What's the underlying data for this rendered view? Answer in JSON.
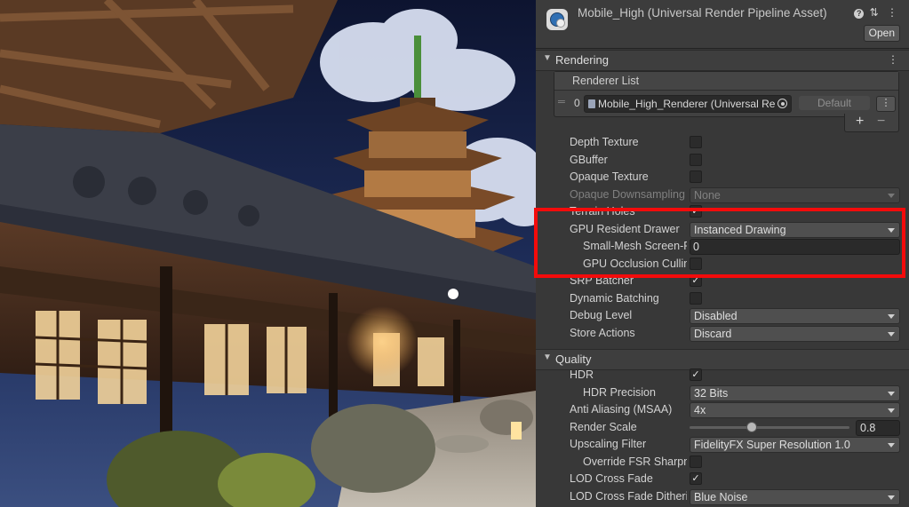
{
  "inspector": {
    "asset_title": "Mobile_High (Universal Render Pipeline Asset)",
    "header_icons": "⋮",
    "open_label": "Open",
    "rendering": {
      "title": "Rendering",
      "renderer_list": {
        "title": "Renderer List",
        "index": "0",
        "renderer": "Mobile_High_Renderer (Universal Re",
        "default_label": "Default",
        "add": "+",
        "remove": "−"
      },
      "props": [
        {
          "label": "Depth Texture",
          "type": "checkbox",
          "checked": false
        },
        {
          "label": "GBuffer",
          "type": "checkbox",
          "checked": false
        },
        {
          "label": "Opaque Texture",
          "type": "checkbox",
          "checked": false
        },
        {
          "label": "Opaque Downsampling",
          "type": "dropdown",
          "value": "None",
          "disabled": true
        },
        {
          "label": "Terrain Holes",
          "type": "checkbox",
          "checked": true
        },
        {
          "label": "GPU Resident Drawer",
          "type": "dropdown",
          "value": "Instanced Drawing"
        },
        {
          "label": "Small-Mesh Screen-P",
          "type": "text",
          "value": "0",
          "indent": true
        },
        {
          "label": "GPU Occlusion Cullin",
          "type": "checkbox",
          "checked": false,
          "indent": true
        },
        {
          "label": "SRP Batcher",
          "type": "checkbox",
          "checked": true
        },
        {
          "label": "Dynamic Batching",
          "type": "checkbox",
          "checked": false
        },
        {
          "label": "Debug Level",
          "type": "dropdown",
          "value": "Disabled"
        },
        {
          "label": "Store Actions",
          "type": "dropdown",
          "value": "Discard"
        }
      ]
    },
    "quality": {
      "title": "Quality",
      "props": [
        {
          "label": "HDR",
          "type": "checkbox",
          "checked": true
        },
        {
          "label": "HDR Precision",
          "type": "dropdown",
          "value": "32 Bits",
          "indent": true
        },
        {
          "label": "Anti Aliasing (MSAA)",
          "type": "dropdown",
          "value": "4x"
        },
        {
          "label": "Render Scale",
          "type": "slider",
          "value": "0.8"
        },
        {
          "label": "Upscaling Filter",
          "type": "dropdown",
          "value": "FidelityFX Super Resolution 1.0"
        },
        {
          "label": "Override FSR Sharpn",
          "type": "checkbox",
          "checked": false,
          "indent": true
        },
        {
          "label": "LOD Cross Fade",
          "type": "checkbox",
          "checked": true
        },
        {
          "label": "LOD Cross Fade Ditheri",
          "type": "dropdown",
          "value": "Blue Noise"
        }
      ]
    }
  },
  "highlight_color": "#f30b0b",
  "check_glyph": "✓"
}
